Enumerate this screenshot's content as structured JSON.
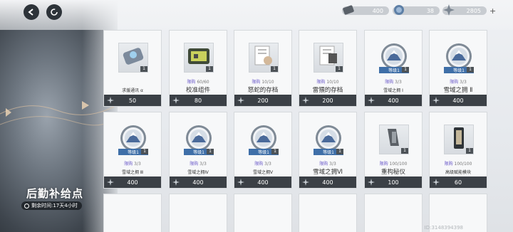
{
  "header": {
    "resources": [
      {
        "icon": "ticket-icon",
        "value": "400",
        "has_plus": false
      },
      {
        "icon": "coin-icon",
        "value": "38",
        "has_plus": false
      },
      {
        "icon": "crystal-icon",
        "value": "2805",
        "has_plus": true
      }
    ],
    "plus": "+"
  },
  "panel": {
    "title": "后勤补给点",
    "timer": "剩余时间:17天4小时"
  },
  "colors": {
    "accent": "#6a58c9",
    "price_bar": "#3b4046",
    "rank_bar": "#3f6fa8"
  },
  "cards": [
    {
      "name": "求援通讯 α",
      "limit_label": "",
      "limit": "",
      "count": "1",
      "price": "50",
      "icon": "radio-device-icon",
      "name_size": "small",
      "rank": ""
    },
    {
      "name": "校准组件",
      "limit_label": "限购",
      "limit": "60/60",
      "count": "1",
      "price": "80",
      "icon": "toolkit-icon",
      "name_size": "big",
      "rank": ""
    },
    {
      "name": "怒蛇的存档",
      "limit_label": "限购",
      "limit": "10/10",
      "count": "1",
      "price": "200",
      "icon": "document-icon",
      "name_size": "big",
      "rank": ""
    },
    {
      "name": "雷猥的存档",
      "limit_label": "限购",
      "limit": "10/10",
      "count": "1",
      "price": "200",
      "icon": "document-photo-icon",
      "name_size": "big",
      "rank": ""
    },
    {
      "name": "雪域之拥 Ⅰ",
      "limit_label": "限购",
      "limit": "3/3",
      "count": "1",
      "price": "400",
      "icon": "snow-medal-icon",
      "name_size": "small",
      "rank": "等级1"
    },
    {
      "name": "雪域之拥 Ⅱ",
      "limit_label": "限购",
      "limit": "3/3",
      "count": "1",
      "price": "400",
      "icon": "snow-medal-icon",
      "name_size": "big",
      "rank": "等级1"
    },
    {
      "name": "雪域之拥 Ⅲ",
      "limit_label": "限购",
      "limit": "3/3",
      "count": "1",
      "price": "400",
      "icon": "snow-medal-icon",
      "name_size": "small",
      "rank": "等级1"
    },
    {
      "name": "雪域之拥Ⅳ",
      "limit_label": "限购",
      "limit": "3/3",
      "count": "1",
      "price": "400",
      "icon": "snow-medal-icon",
      "name_size": "small",
      "rank": "等级1"
    },
    {
      "name": "雪域之拥Ⅴ",
      "limit_label": "限购",
      "limit": "3/3",
      "count": "1",
      "price": "400",
      "icon": "snow-medal-icon",
      "name_size": "small",
      "rank": "等级1"
    },
    {
      "name": "雪域之拥Ⅵ",
      "limit_label": "限购",
      "limit": "3/3",
      "count": "1",
      "price": "400",
      "icon": "snow-medal-icon",
      "name_size": "big",
      "rank": "等级1"
    },
    {
      "name": "重构秘仪",
      "limit_label": "限购",
      "limit": "100/100",
      "count": "1",
      "price": "100",
      "icon": "clamp-tool-icon",
      "name_size": "big",
      "rank": ""
    },
    {
      "name": "高级赋能模块",
      "limit_label": "限购",
      "limit": "100/100",
      "count": "1",
      "price": "60",
      "icon": "module-chip-icon",
      "name_size": "small",
      "rank": ""
    }
  ],
  "uid": "ID:3148394398"
}
